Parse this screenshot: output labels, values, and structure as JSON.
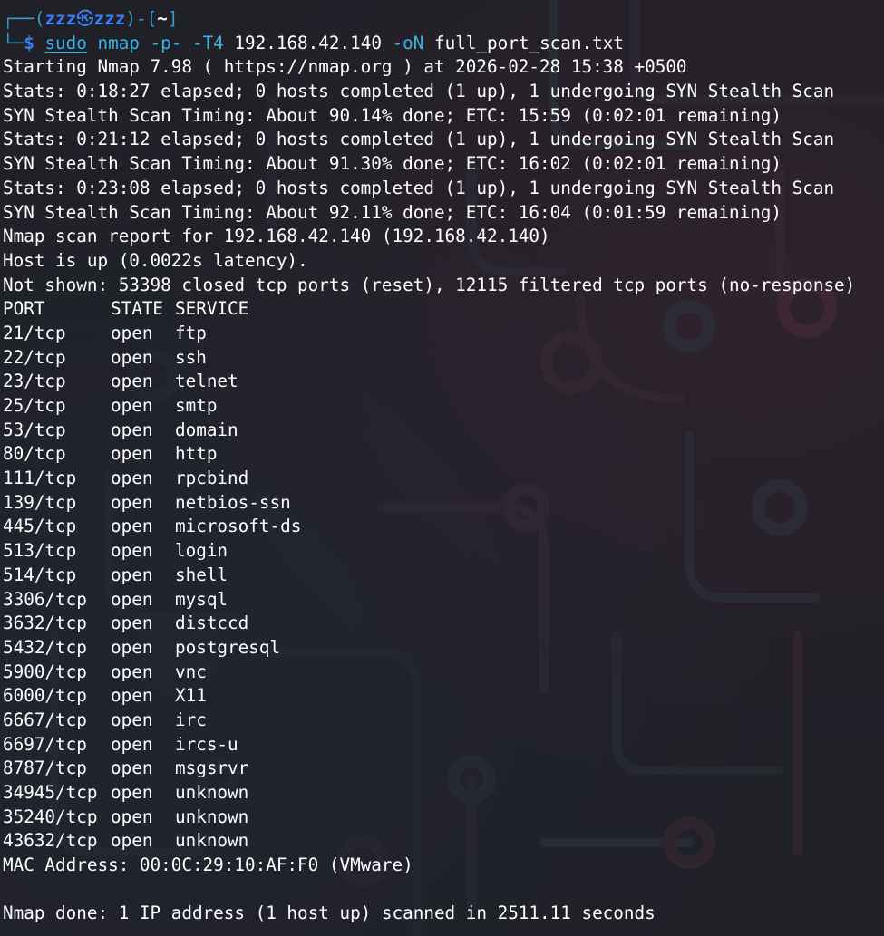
{
  "prompt": {
    "frame_top_left": "┌──(",
    "user": "zzz",
    "at_symbol": "㉿",
    "host": "zzz",
    "frame_mid": ")-[",
    "cwd": "~",
    "frame_close": "]",
    "frame_bottom": "└─",
    "dollar": "$"
  },
  "command": {
    "sudo": "sudo",
    "program": "nmap",
    "flag_ports": "-p-",
    "flag_timing": "-T4",
    "target": "192.168.42.140",
    "flag_output": "-oN",
    "output_file": "full_port_scan.txt"
  },
  "output_header": [
    "Starting Nmap 7.98 ( https://nmap.org ) at 2026-02-28 15:38 +0500",
    "Stats: 0:18:27 elapsed; 0 hosts completed (1 up), 1 undergoing SYN Stealth Scan",
    "SYN Stealth Scan Timing: About 90.14% done; ETC: 15:59 (0:02:01 remaining)",
    "Stats: 0:21:12 elapsed; 0 hosts completed (1 up), 1 undergoing SYN Stealth Scan",
    "SYN Stealth Scan Timing: About 91.30% done; ETC: 16:02 (0:02:01 remaining)",
    "Stats: 0:23:08 elapsed; 0 hosts completed (1 up), 1 undergoing SYN Stealth Scan",
    "SYN Stealth Scan Timing: About 92.11% done; ETC: 16:04 (0:01:59 remaining)",
    "Nmap scan report for 192.168.42.140 (192.168.42.140)",
    "Host is up (0.0022s latency).",
    "Not shown: 53398 closed tcp ports (reset), 12115 filtered tcp ports (no-response)"
  ],
  "port_table": {
    "headers": [
      "PORT",
      "STATE",
      "SERVICE"
    ],
    "rows": [
      [
        "21/tcp",
        "open",
        "ftp"
      ],
      [
        "22/tcp",
        "open",
        "ssh"
      ],
      [
        "23/tcp",
        "open",
        "telnet"
      ],
      [
        "25/tcp",
        "open",
        "smtp"
      ],
      [
        "53/tcp",
        "open",
        "domain"
      ],
      [
        "80/tcp",
        "open",
        "http"
      ],
      [
        "111/tcp",
        "open",
        "rpcbind"
      ],
      [
        "139/tcp",
        "open",
        "netbios-ssn"
      ],
      [
        "445/tcp",
        "open",
        "microsoft-ds"
      ],
      [
        "513/tcp",
        "open",
        "login"
      ],
      [
        "514/tcp",
        "open",
        "shell"
      ],
      [
        "3306/tcp",
        "open",
        "mysql"
      ],
      [
        "3632/tcp",
        "open",
        "distccd"
      ],
      [
        "5432/tcp",
        "open",
        "postgresql"
      ],
      [
        "5900/tcp",
        "open",
        "vnc"
      ],
      [
        "6000/tcp",
        "open",
        "X11"
      ],
      [
        "6667/tcp",
        "open",
        "irc"
      ],
      [
        "6697/tcp",
        "open",
        "ircs-u"
      ],
      [
        "8787/tcp",
        "open",
        "msgsrvr"
      ],
      [
        "34945/tcp",
        "open",
        "unknown"
      ],
      [
        "35240/tcp",
        "open",
        "unknown"
      ],
      [
        "43632/tcp",
        "open",
        "unknown"
      ]
    ]
  },
  "mac_line": "MAC Address: 00:0C:29:10:AF:F0 (VMware)",
  "blank_line": "",
  "done_line": "Nmap done: 1 IP address (1 host up) scanned in 2511.11 seconds"
}
